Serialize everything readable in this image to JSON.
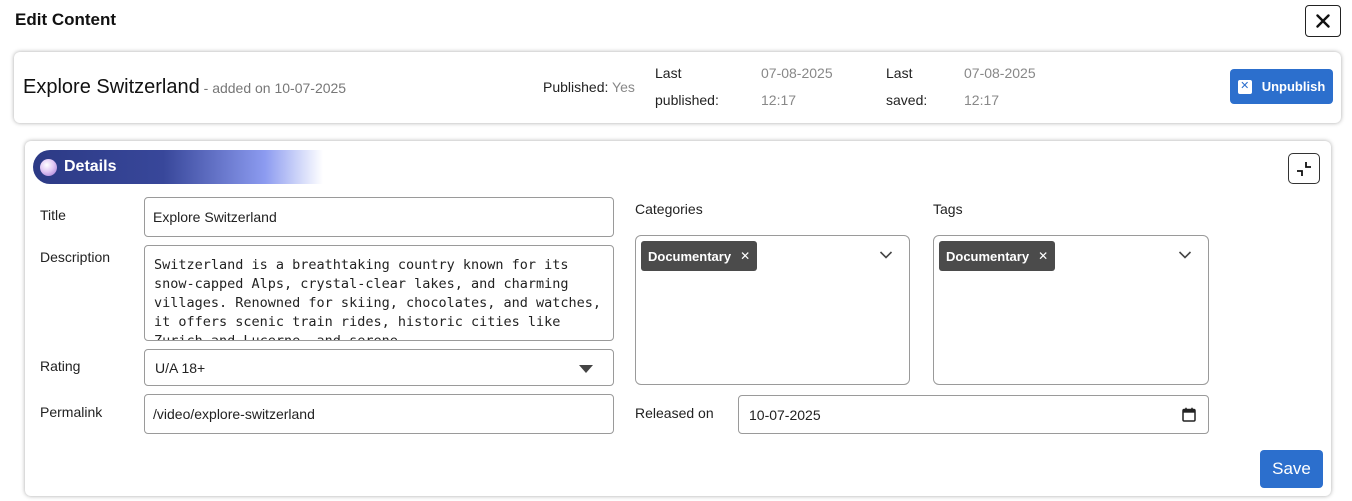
{
  "page": {
    "title": "Edit Content"
  },
  "header": {
    "content_title": "Explore Switzerland",
    "added_on": " - added on 10-07-2025",
    "published_label": "Published:",
    "published_value": "Yes",
    "last_published_label_1": "Last",
    "last_published_label_2": "published:",
    "last_published_date": "07-08-2025",
    "last_published_time": "12:17",
    "last_saved_label_1": "Last",
    "last_saved_label_2": "saved:",
    "last_saved_date": "07-08-2025",
    "last_saved_time": "12:17",
    "unpublish_label": "Unpublish"
  },
  "details": {
    "section_title": "Details",
    "title_label": "Title",
    "title_value": "Explore Switzerland",
    "description_label": "Description",
    "description_value": "Switzerland is a breathtaking country known for its snow-capped Alps, crystal-clear lakes, and charming villages. Renowned for skiing, chocolates, and watches, it offers scenic train rides, historic cities like Zurich and Lucerne, and serene",
    "rating_label": "Rating",
    "rating_value": "U/A 18+",
    "permalink_label": "Permalink",
    "permalink_value": "/video/explore-switzerland",
    "categories_label": "Categories",
    "categories": [
      "Documentary"
    ],
    "tags_label": "Tags",
    "tags": [
      "Documentary"
    ],
    "released_label": "Released on",
    "released_value": "10-07-2025",
    "save_label": "Save"
  },
  "colors": {
    "primary": "#2c6fcd",
    "banner_dark": "#2c3a85",
    "chip": "#4b4b4b"
  }
}
